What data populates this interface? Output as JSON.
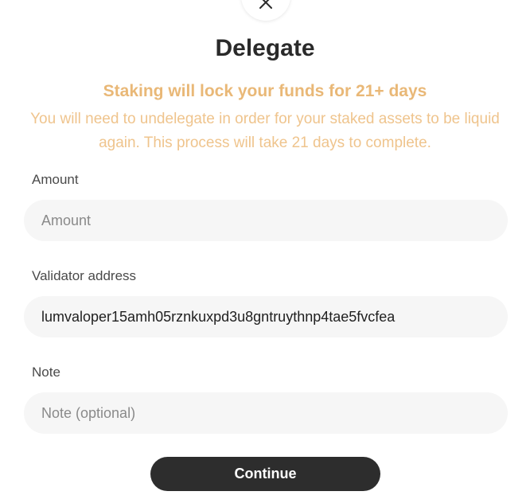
{
  "modal": {
    "title": "Delegate",
    "warning_title": "Staking will lock your funds for 21+ days",
    "warning_text": "You will need to undelegate in order for your staked assets to be liquid again. This process will take 21 days to complete."
  },
  "form": {
    "amount_label": "Amount",
    "amount_placeholder": "Amount",
    "amount_value": "",
    "validator_label": "Validator address",
    "validator_value": "lumvaloper15amh05rznkuxpd3u8gntruythnp4tae5fvcfea",
    "note_label": "Note",
    "note_placeholder": "Note (optional)",
    "note_value": ""
  },
  "actions": {
    "continue_label": "Continue"
  },
  "icons": {
    "close": "close-icon"
  },
  "colors": {
    "warning": "#e9b877",
    "button": "#2d2d2d",
    "field_background": "#f6f6f6"
  }
}
